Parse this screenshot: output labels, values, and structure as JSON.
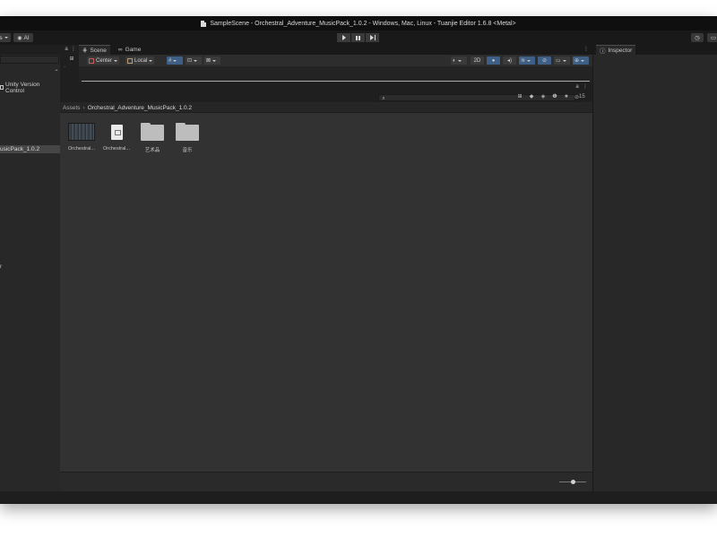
{
  "window": {
    "title": "SampleScene - Orchestral_Adventure_MusicPack_1.0.2 - Windows, Mac, Linux - Tuanjie Editor 1.6.8 <Metal>"
  },
  "toolbar": {
    "left_dropdown_label": "s",
    "ai_label": "AI"
  },
  "hierarchy": {
    "version_control_label": "Unity Version Control",
    "selected_item": "usicPack_1.0.2",
    "other_item": "r"
  },
  "scene": {
    "tabs": [
      {
        "label": "Scene",
        "active": true
      },
      {
        "label": "Game",
        "active": false
      }
    ],
    "pivot_label": "Center",
    "space_label": "Local",
    "mode_2d_label": "2D"
  },
  "project": {
    "breadcrumb": [
      "Assets",
      "Orchestral_Adventure_MusicPack_1.0.2"
    ],
    "hidden_count": "15",
    "assets": [
      {
        "label": "Orchestral...",
        "kind": "scene"
      },
      {
        "label": "Orchestral...",
        "kind": "document"
      },
      {
        "label": "艺术品",
        "kind": "folder"
      },
      {
        "label": "音乐",
        "kind": "folder"
      }
    ]
  },
  "inspector": {
    "tab_label": "Inspector"
  },
  "colors": {
    "accent_blue": "#3e5f86",
    "panel_bg": "#282828",
    "content_bg": "#323232",
    "window_bg": "#191919"
  }
}
